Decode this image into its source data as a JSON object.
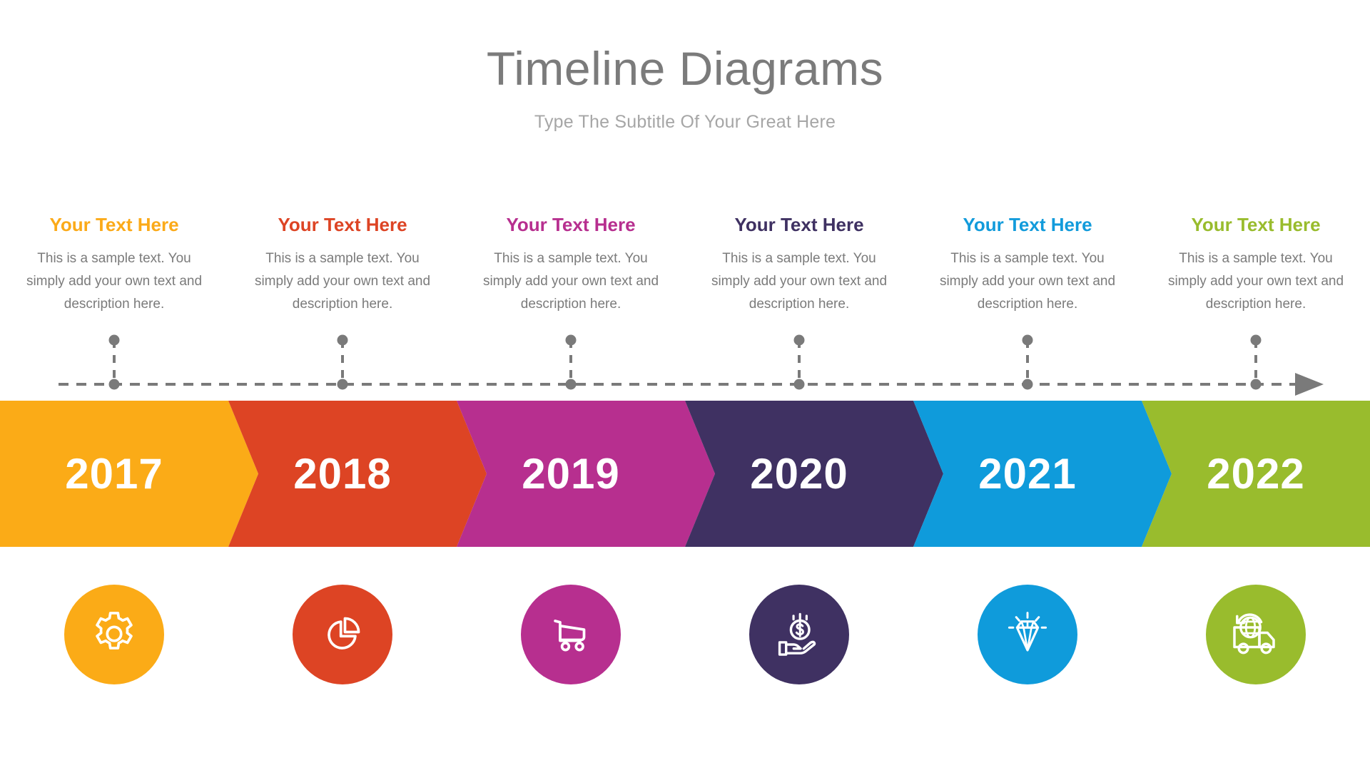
{
  "header": {
    "title": "Timeline Diagrams",
    "subtitle": "Type The Subtitle Of Your Great Here"
  },
  "colors": {
    "title_gray": "#7b7b7b",
    "subtitle_gray": "#a6a6a6",
    "body_gray": "#7b7b7b",
    "connector_gray": "#7a7a7a",
    "white": "#ffffff"
  },
  "columns": [
    {
      "title": "Your Text Here",
      "title_color": "#fbaa19",
      "body": "This is a sample text. You simply add your own text and description here.",
      "year": "2017",
      "band_color": "#fbab17",
      "icon": "gear-icon",
      "icon_circle_color": "#fbab17"
    },
    {
      "title": "Your Text Here",
      "title_color": "#dd4424",
      "body": "This is a sample text. You simply add your own text and description here.",
      "year": "2018",
      "band_color": "#dd4424",
      "icon": "pie-chart-icon",
      "icon_circle_color": "#dd4424"
    },
    {
      "title": "Your Text Here",
      "title_color": "#b72f8f",
      "body": "This is a sample text. You simply add your own text and description here.",
      "year": "2019",
      "band_color": "#b72f8f",
      "icon": "shopping-cart-icon",
      "icon_circle_color": "#b72f8f"
    },
    {
      "title": "Your Text Here",
      "title_color": "#3f3162",
      "body": "This is a sample text. You simply add your own text and description here.",
      "year": "2020",
      "band_color": "#3f3162",
      "icon": "hand-money-icon",
      "icon_circle_color": "#3f3162"
    },
    {
      "title": "Your Text Here",
      "title_color": "#129bdb",
      "body": "This is a sample text. You simply add your own text and description here.",
      "year": "2021",
      "band_color": "#0f9bdb",
      "icon": "diamond-icon",
      "icon_circle_color": "#0f9bdb"
    },
    {
      "title": "Your Text Here",
      "title_color": "#99bc2d",
      "body": "This is a sample text. You simply add your own text and description here.",
      "year": "2022",
      "band_color": "#99bc2d",
      "icon": "delivery-truck-icon",
      "icon_circle_color": "#99bc2d"
    }
  ],
  "timeline_axis": {
    "arrow_direction": "right",
    "style": "dashed",
    "node_count": 6
  }
}
